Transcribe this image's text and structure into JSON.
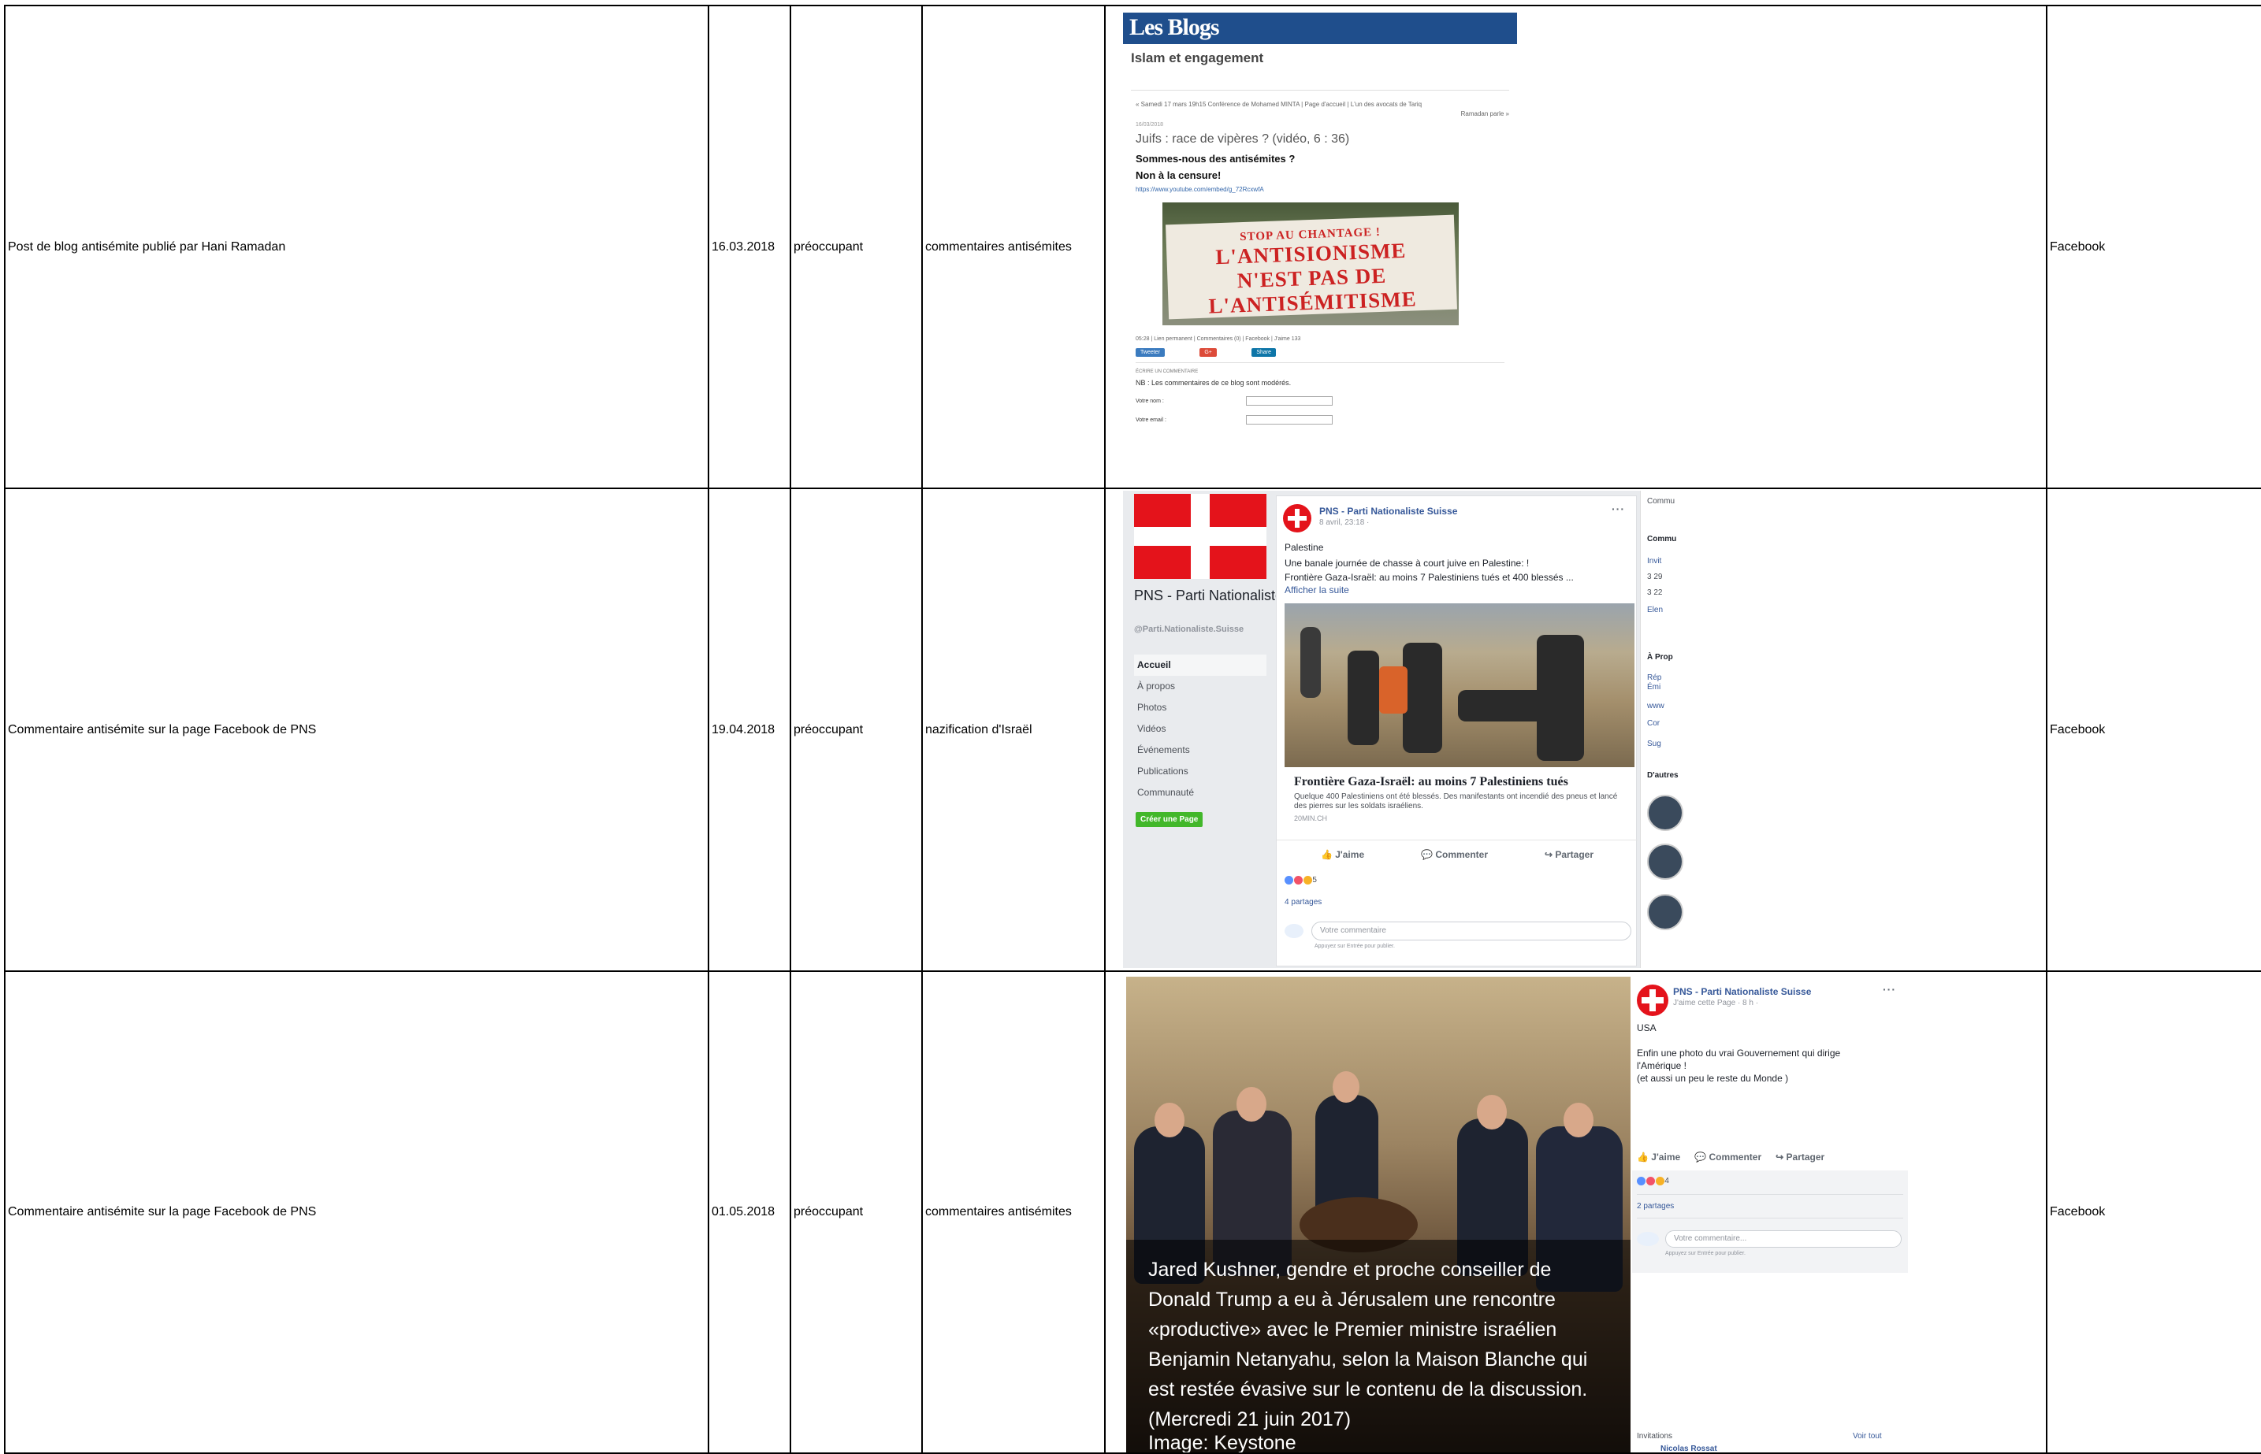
{
  "rows": [
    {
      "description": "Post de blog antisémite publié par Hani Ramadan",
      "date": "16.03.2018",
      "level": "préoccupant",
      "category": "commentaires antisémites",
      "platform": "Facebook"
    },
    {
      "description": "Commentaire antisémite sur la page Facebook de PNS",
      "date": "19.04.2018",
      "level": "préoccupant",
      "category": "nazification d'Israël",
      "platform": "Facebook"
    },
    {
      "description": "Commentaire antisémite sur la page Facebook de PNS",
      "date": "01.05.2018",
      "level": "préoccupant",
      "category": "commentaires antisémites",
      "platform": "Facebook"
    }
  ],
  "blog": {
    "header": "Les Blogs",
    "subtitle": "Islam et engagement",
    "nav_line1": "« Samedi 17 mars 19h15 Conférence de Mohamed MINTA | Page d'accueil | L'un des avocats de Tariq",
    "nav_line2": "Ramadan parle »",
    "date": "16/03/2018",
    "post_title": "Juifs : race de vipères ? (vidéo, 6 : 36)",
    "line1": "Sommes-nous des antisémites ?",
    "line2": "Non à la censure!",
    "link": "https://www.youtube.com/embed/g_72RcxwfA",
    "banner_line1": "STOP AU CHANTAGE !",
    "banner_line2": "L'ANTISIONISME",
    "banner_line3": "N'EST PAS DE",
    "banner_line4": "L'ANTISÉMITISME",
    "footer": "05:28 | Lien permanent | Commentaires (0) | Facebook | J'aime 133",
    "tweet": "Tweeter",
    "gplus": "G+",
    "share": "Share",
    "ecrire": "ÉCRIRE UN COMMENTAIRE",
    "nb": "NB : Les commentaires de ce blog sont modérés.",
    "name_label": "Votre nom :",
    "email_label": "Votre email :"
  },
  "fbpage": {
    "page_name": "PNS - Parti Nationaliste Suisse",
    "handle": "@Parti.Nationaliste.Suisse",
    "nav": [
      "Accueil",
      "À propos",
      "Photos",
      "Vidéos",
      "Événements",
      "Publications",
      "Communauté"
    ],
    "create_page": "Créer une Page",
    "author": "PNS - Parti Nationaliste Suisse",
    "time": "8 avril, 23:18 · ",
    "text1": "Palestine",
    "text2": "Une banale journée de chasse à court juive en Palestine: !",
    "text3": "Frontière Gaza-Israël: au moins 7 Palestiniens tués et 400 blessés ...",
    "see_more": "Afficher la suite",
    "headline": "Frontière Gaza-Israël: au moins 7 Palestiniens tués",
    "desc": "Quelque 400 Palestiniens ont été blessés. Des manifestants ont incendié des pneus et lancé des pierres sur les soldats israéliens.",
    "source": "20MIN.CH",
    "like": "J'aime",
    "comment": "Commenter",
    "share": "Partager",
    "reaction_count": "5",
    "shares": "4 partages",
    "comment_placeholder": "Votre commentaire",
    "hint": "Appuyez sur Entrée pour publier.",
    "right_labels": {
      "commu": "Commu",
      "communaute": "Commu",
      "r1": "Invit",
      "r2": "3 29",
      "r3": "3 22",
      "r4": "Elen",
      "apropos": "À Prop",
      "a1": "Rép",
      "a1b": "Émi",
      "a2": "www",
      "a3": "Cor",
      "a4": "Sug",
      "autres": "D'autres"
    }
  },
  "fbpost2": {
    "caption": [
      "Jared Kushner, gendre et proche conseiller de",
      "Donald Trump a eu à Jérusalem une rencontre",
      "«productive» avec le Premier ministre israélien",
      "Benjamin Netanyahu, selon la Maison Blanche qui",
      "est restée évasive sur le contenu de la discussion.",
      "(Mercredi 21 juin 2017)",
      "Image: Keystone"
    ],
    "author": "PNS - Parti Nationaliste Suisse",
    "meta": "J'aime cette Page · 8 h · ",
    "text1": "USA",
    "text2": "Enfin une photo du vrai Gouvernement qui dirige",
    "text3": "l'Amérique !",
    "text4": "(et aussi un peu le reste du Monde )",
    "like": "J'aime",
    "comment": "Commenter",
    "share": "Partager",
    "reaction_count": "4",
    "shares": "2 partages",
    "comment_placeholder": "Votre commentaire...",
    "hint": "Appuyez sur Entrée pour publier.",
    "invitations": "Invitations",
    "see_all": "Voir tout",
    "invitee": "Nicolas Rossat"
  },
  "colors": {
    "blog_header": "#1f4e8c",
    "fb_link": "#365899",
    "swiss_red": "#e4131b",
    "create_green": "#42b72a"
  }
}
